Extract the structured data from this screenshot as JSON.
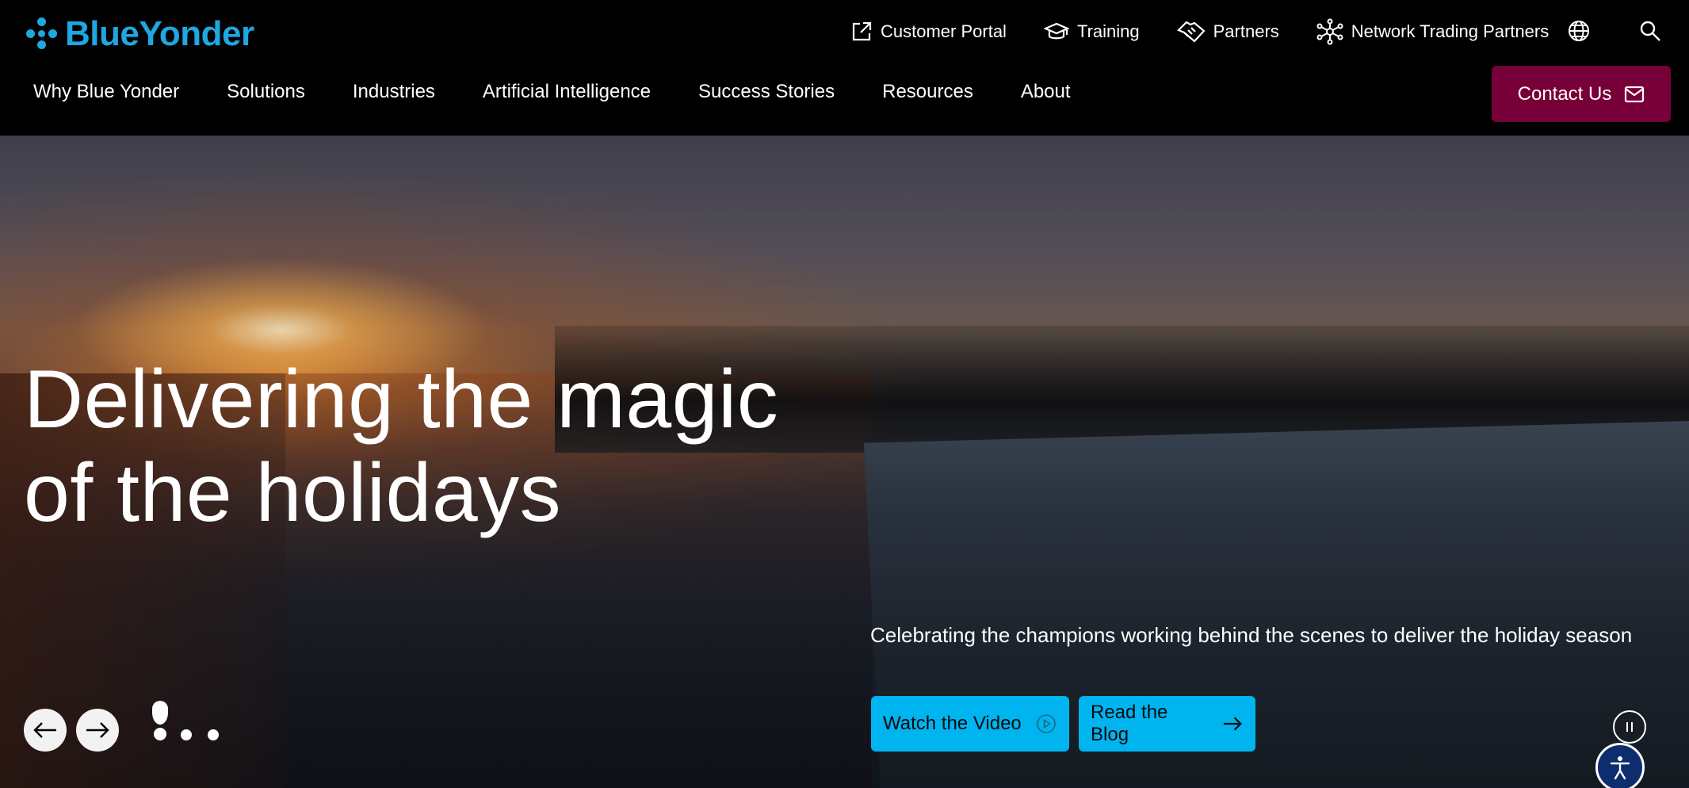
{
  "brand": {
    "name": "BlueYonder",
    "color": "#1ea7e1"
  },
  "utility_nav": [
    {
      "label": "Customer Portal",
      "icon": "external-link-icon"
    },
    {
      "label": "Training",
      "icon": "graduation-cap-icon"
    },
    {
      "label": "Partners",
      "icon": "handshake-icon"
    },
    {
      "label": "Network Trading Partners",
      "icon": "network-icon"
    }
  ],
  "utility_icons": {
    "language": "globe-icon",
    "search": "search-icon"
  },
  "main_nav": [
    {
      "label": "Why Blue Yonder"
    },
    {
      "label": "Solutions"
    },
    {
      "label": "Industries"
    },
    {
      "label": "Artificial Intelligence"
    },
    {
      "label": "Success Stories"
    },
    {
      "label": "Resources"
    },
    {
      "label": "About"
    }
  ],
  "contact": {
    "label": "Contact Us",
    "icon": "mail-icon",
    "color": "#780038"
  },
  "hero": {
    "headline_line1": "Delivering the magic",
    "headline_line2": "of the holidays",
    "subtext": "Celebrating the champions working behind the scenes to deliver the holiday season",
    "cta_video": {
      "label": "Watch the Video",
      "icon": "play-circle-icon"
    },
    "cta_blog": {
      "label": "Read the Blog",
      "icon": "arrow-right-icon"
    },
    "cta_color": "#00b4ef",
    "slide_count": 3,
    "active_slide": 1,
    "controls": {
      "prev": "arrow-left-icon",
      "next": "arrow-right-icon",
      "pause": "pause-icon",
      "accessibility": "accessibility-icon"
    }
  }
}
